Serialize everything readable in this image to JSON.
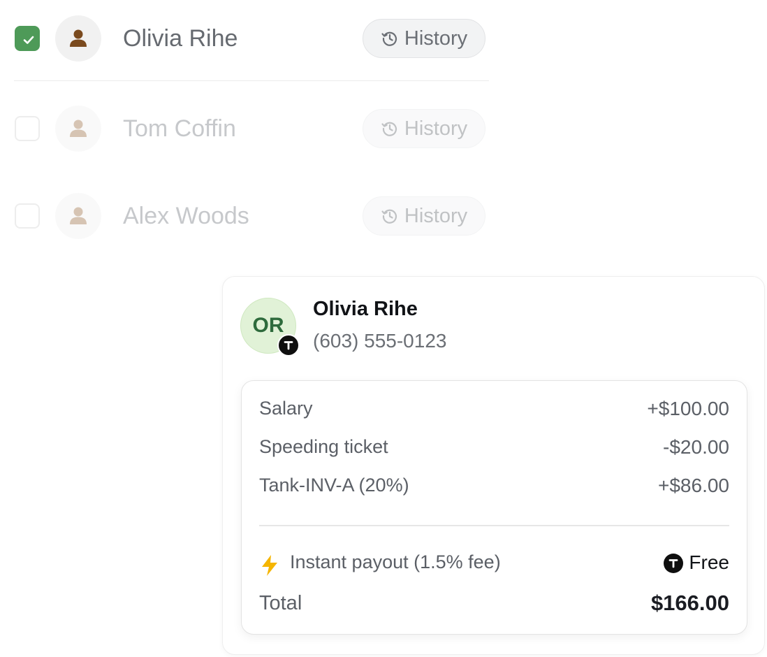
{
  "people": [
    {
      "name": "Olivia Rihe",
      "checked": true,
      "history_label": "History",
      "avatar_icon": "person-icon",
      "avatar_color": "#7a4a1e"
    },
    {
      "name": "Tom Coffin",
      "checked": false,
      "history_label": "History",
      "avatar_icon": "person-icon",
      "avatar_color": "#a0744b"
    },
    {
      "name": "Alex Woods",
      "checked": false,
      "history_label": "History",
      "avatar_icon": "person-icon",
      "avatar_color": "#a0744b"
    }
  ],
  "card": {
    "initials": "OR",
    "name": "Olivia Rihe",
    "phone": "(603) 555-0123",
    "line_items": [
      {
        "label": "Salary",
        "amount": "+$100.00"
      },
      {
        "label": "Speeding ticket",
        "amount": "-$20.00"
      },
      {
        "label": "Tank-INV-A (20%)",
        "amount": "+$86.00"
      }
    ],
    "payout": {
      "label": "Instant payout (1.5% fee)",
      "fee": "Free",
      "icon": "lightning-icon"
    },
    "total": {
      "label": "Total",
      "amount": "$166.00"
    }
  },
  "colors": {
    "checkbox_checked": "#4e9a58",
    "avatar_bg": "#e1f2d7",
    "initials": "#2e6b3c",
    "bolt": "#f5b500"
  }
}
